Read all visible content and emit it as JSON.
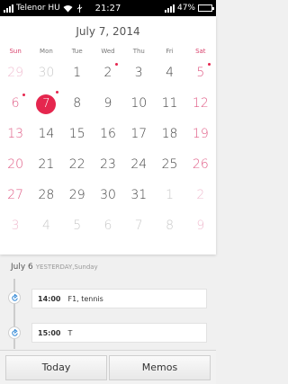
{
  "status_bar": {
    "carrier": "Telenor HU",
    "time": "21:27",
    "battery_percent": "47%",
    "battery_level": 0.47,
    "icons": [
      "signal-icon",
      "wifi-icon",
      "usb-icon",
      "signal-icon",
      "battery-icon"
    ]
  },
  "calendar": {
    "title": "July 7, 2014",
    "weekdays": [
      "Sun",
      "Mon",
      "Tue",
      "Wed",
      "Thu",
      "Fri",
      "Sat"
    ],
    "weeks": [
      [
        {
          "d": "29",
          "faded": true
        },
        {
          "d": "30",
          "faded": true
        },
        {
          "d": "1"
        },
        {
          "d": "2",
          "dot": true
        },
        {
          "d": "3"
        },
        {
          "d": "4"
        },
        {
          "d": "5",
          "dot": true
        }
      ],
      [
        {
          "d": "6",
          "dot": true
        },
        {
          "d": "7",
          "today": true,
          "dot": true
        },
        {
          "d": "8"
        },
        {
          "d": "9"
        },
        {
          "d": "10"
        },
        {
          "d": "11"
        },
        {
          "d": "12"
        }
      ],
      [
        {
          "d": "13"
        },
        {
          "d": "14"
        },
        {
          "d": "15"
        },
        {
          "d": "16"
        },
        {
          "d": "17"
        },
        {
          "d": "18"
        },
        {
          "d": "19"
        }
      ],
      [
        {
          "d": "20"
        },
        {
          "d": "21"
        },
        {
          "d": "22"
        },
        {
          "d": "23"
        },
        {
          "d": "24"
        },
        {
          "d": "25"
        },
        {
          "d": "26"
        }
      ],
      [
        {
          "d": "27"
        },
        {
          "d": "28"
        },
        {
          "d": "29"
        },
        {
          "d": "30"
        },
        {
          "d": "31"
        },
        {
          "d": "1",
          "faded": true
        },
        {
          "d": "2",
          "faded": true
        }
      ],
      [
        {
          "d": "3",
          "faded": true
        },
        {
          "d": "4",
          "faded": true
        },
        {
          "d": "5",
          "faded": true
        },
        {
          "d": "6",
          "faded": true
        },
        {
          "d": "7",
          "faded": true
        },
        {
          "d": "8",
          "faded": true
        },
        {
          "d": "9",
          "faded": true
        }
      ]
    ],
    "accent_color": "#e5264e"
  },
  "agenda": {
    "date": "July 6",
    "subtitle": "YESTERDAY,Sunday",
    "events": [
      {
        "time": "14:00",
        "title": "F1, tennis"
      },
      {
        "time": "15:00",
        "title": "T"
      }
    ]
  },
  "bottom_bar": {
    "today_label": "Today",
    "memos_label": "Memos"
  }
}
